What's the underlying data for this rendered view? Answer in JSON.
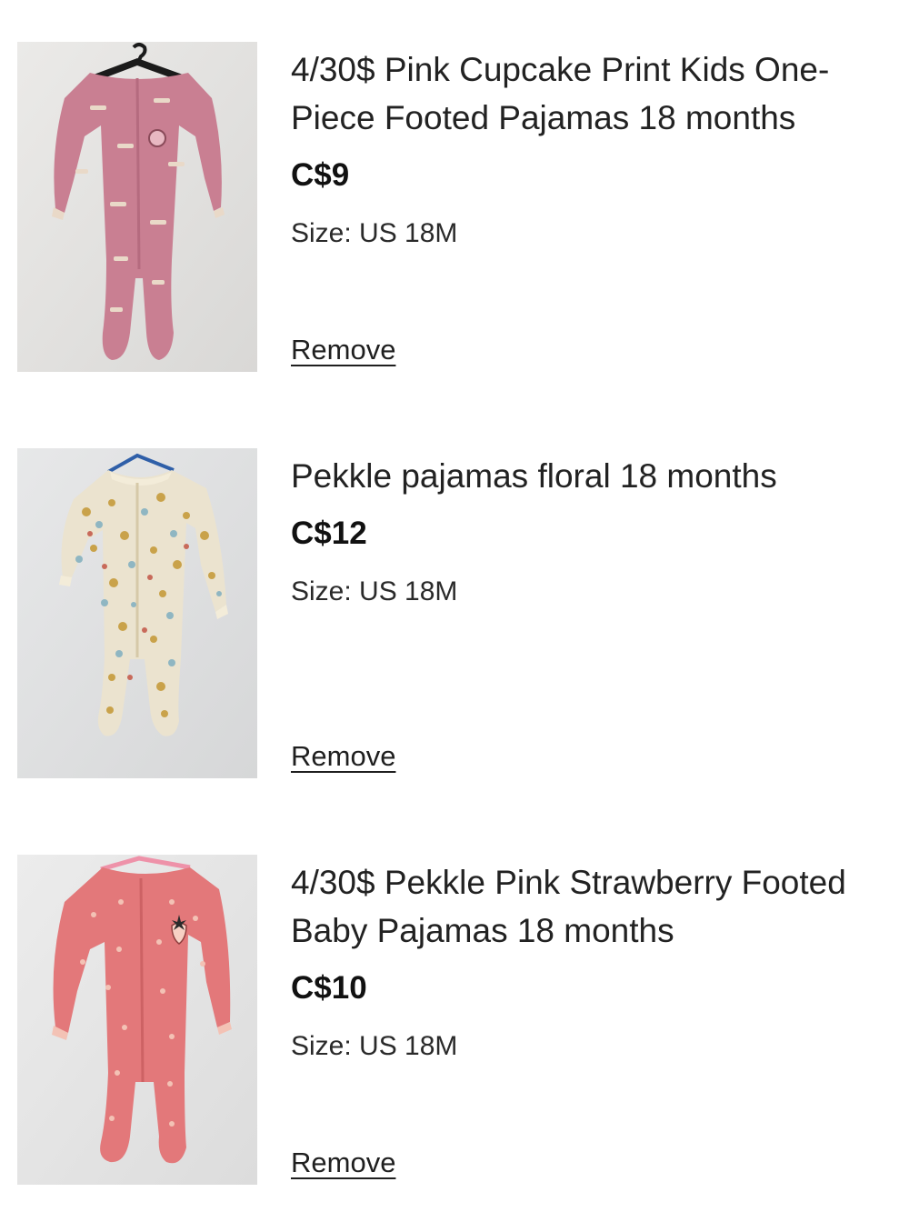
{
  "cart": {
    "items": [
      {
        "title": "4/30$ Pink Cupcake Print Kids One-Piece Footed Pajamas 18 months",
        "price": "C$9",
        "size": "Size: US 18M",
        "remove_label": "Remove",
        "image": {
          "subject": "pink cupcake print footed pajamas on hanger",
          "fabric_color": "#c97f92",
          "accent_color": "#e9d9c8",
          "hanger_color": "#1b1b1b",
          "background_color": "#e4e3e1"
        }
      },
      {
        "title": "Pekkle pajamas floral 18 months",
        "price": "C$12",
        "size": "Size: US 18M",
        "remove_label": "Remove",
        "image": {
          "subject": "floral print footed pajamas on blue hanger",
          "fabric_color": "#ebe3cf",
          "accent_color": "#c9a24a",
          "hanger_color": "#2f5fa8",
          "background_color": "#e2e3e4"
        }
      },
      {
        "title": "4/30$ Pekkle Pink Strawberry Footed Baby Pajamas 18 months",
        "price": "C$10",
        "size": "Size: US 18M",
        "remove_label": "Remove",
        "image": {
          "subject": "pink strawberry print footed pajamas on pink hanger",
          "fabric_color": "#e3787a",
          "accent_color": "#f3c2b5",
          "hanger_color": "#ee92a9",
          "background_color": "#e6e6e6"
        }
      }
    ]
  }
}
